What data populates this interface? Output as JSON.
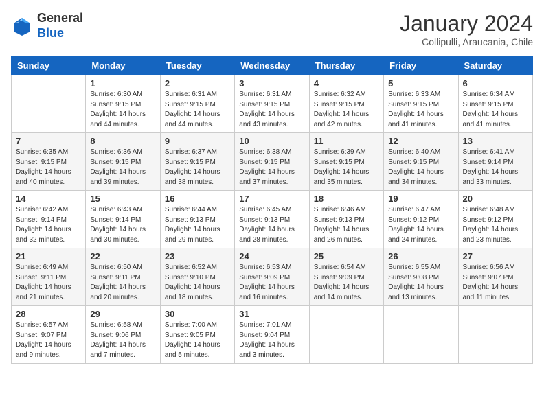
{
  "header": {
    "logo_general": "General",
    "logo_blue": "Blue",
    "month_title": "January 2024",
    "subtitle": "Collipulli, Araucania, Chile"
  },
  "days_of_week": [
    "Sunday",
    "Monday",
    "Tuesday",
    "Wednesday",
    "Thursday",
    "Friday",
    "Saturday"
  ],
  "weeks": [
    [
      {
        "day": "",
        "sunrise": "",
        "sunset": "",
        "daylight": ""
      },
      {
        "day": "1",
        "sunrise": "Sunrise: 6:30 AM",
        "sunset": "Sunset: 9:15 PM",
        "daylight": "Daylight: 14 hours and 44 minutes."
      },
      {
        "day": "2",
        "sunrise": "Sunrise: 6:31 AM",
        "sunset": "Sunset: 9:15 PM",
        "daylight": "Daylight: 14 hours and 44 minutes."
      },
      {
        "day": "3",
        "sunrise": "Sunrise: 6:31 AM",
        "sunset": "Sunset: 9:15 PM",
        "daylight": "Daylight: 14 hours and 43 minutes."
      },
      {
        "day": "4",
        "sunrise": "Sunrise: 6:32 AM",
        "sunset": "Sunset: 9:15 PM",
        "daylight": "Daylight: 14 hours and 42 minutes."
      },
      {
        "day": "5",
        "sunrise": "Sunrise: 6:33 AM",
        "sunset": "Sunset: 9:15 PM",
        "daylight": "Daylight: 14 hours and 41 minutes."
      },
      {
        "day": "6",
        "sunrise": "Sunrise: 6:34 AM",
        "sunset": "Sunset: 9:15 PM",
        "daylight": "Daylight: 14 hours and 41 minutes."
      }
    ],
    [
      {
        "day": "7",
        "sunrise": "Sunrise: 6:35 AM",
        "sunset": "Sunset: 9:15 PM",
        "daylight": "Daylight: 14 hours and 40 minutes."
      },
      {
        "day": "8",
        "sunrise": "Sunrise: 6:36 AM",
        "sunset": "Sunset: 9:15 PM",
        "daylight": "Daylight: 14 hours and 39 minutes."
      },
      {
        "day": "9",
        "sunrise": "Sunrise: 6:37 AM",
        "sunset": "Sunset: 9:15 PM",
        "daylight": "Daylight: 14 hours and 38 minutes."
      },
      {
        "day": "10",
        "sunrise": "Sunrise: 6:38 AM",
        "sunset": "Sunset: 9:15 PM",
        "daylight": "Daylight: 14 hours and 37 minutes."
      },
      {
        "day": "11",
        "sunrise": "Sunrise: 6:39 AM",
        "sunset": "Sunset: 9:15 PM",
        "daylight": "Daylight: 14 hours and 35 minutes."
      },
      {
        "day": "12",
        "sunrise": "Sunrise: 6:40 AM",
        "sunset": "Sunset: 9:15 PM",
        "daylight": "Daylight: 14 hours and 34 minutes."
      },
      {
        "day": "13",
        "sunrise": "Sunrise: 6:41 AM",
        "sunset": "Sunset: 9:14 PM",
        "daylight": "Daylight: 14 hours and 33 minutes."
      }
    ],
    [
      {
        "day": "14",
        "sunrise": "Sunrise: 6:42 AM",
        "sunset": "Sunset: 9:14 PM",
        "daylight": "Daylight: 14 hours and 32 minutes."
      },
      {
        "day": "15",
        "sunrise": "Sunrise: 6:43 AM",
        "sunset": "Sunset: 9:14 PM",
        "daylight": "Daylight: 14 hours and 30 minutes."
      },
      {
        "day": "16",
        "sunrise": "Sunrise: 6:44 AM",
        "sunset": "Sunset: 9:13 PM",
        "daylight": "Daylight: 14 hours and 29 minutes."
      },
      {
        "day": "17",
        "sunrise": "Sunrise: 6:45 AM",
        "sunset": "Sunset: 9:13 PM",
        "daylight": "Daylight: 14 hours and 28 minutes."
      },
      {
        "day": "18",
        "sunrise": "Sunrise: 6:46 AM",
        "sunset": "Sunset: 9:13 PM",
        "daylight": "Daylight: 14 hours and 26 minutes."
      },
      {
        "day": "19",
        "sunrise": "Sunrise: 6:47 AM",
        "sunset": "Sunset: 9:12 PM",
        "daylight": "Daylight: 14 hours and 24 minutes."
      },
      {
        "day": "20",
        "sunrise": "Sunrise: 6:48 AM",
        "sunset": "Sunset: 9:12 PM",
        "daylight": "Daylight: 14 hours and 23 minutes."
      }
    ],
    [
      {
        "day": "21",
        "sunrise": "Sunrise: 6:49 AM",
        "sunset": "Sunset: 9:11 PM",
        "daylight": "Daylight: 14 hours and 21 minutes."
      },
      {
        "day": "22",
        "sunrise": "Sunrise: 6:50 AM",
        "sunset": "Sunset: 9:11 PM",
        "daylight": "Daylight: 14 hours and 20 minutes."
      },
      {
        "day": "23",
        "sunrise": "Sunrise: 6:52 AM",
        "sunset": "Sunset: 9:10 PM",
        "daylight": "Daylight: 14 hours and 18 minutes."
      },
      {
        "day": "24",
        "sunrise": "Sunrise: 6:53 AM",
        "sunset": "Sunset: 9:09 PM",
        "daylight": "Daylight: 14 hours and 16 minutes."
      },
      {
        "day": "25",
        "sunrise": "Sunrise: 6:54 AM",
        "sunset": "Sunset: 9:09 PM",
        "daylight": "Daylight: 14 hours and 14 minutes."
      },
      {
        "day": "26",
        "sunrise": "Sunrise: 6:55 AM",
        "sunset": "Sunset: 9:08 PM",
        "daylight": "Daylight: 14 hours and 13 minutes."
      },
      {
        "day": "27",
        "sunrise": "Sunrise: 6:56 AM",
        "sunset": "Sunset: 9:07 PM",
        "daylight": "Daylight: 14 hours and 11 minutes."
      }
    ],
    [
      {
        "day": "28",
        "sunrise": "Sunrise: 6:57 AM",
        "sunset": "Sunset: 9:07 PM",
        "daylight": "Daylight: 14 hours and 9 minutes."
      },
      {
        "day": "29",
        "sunrise": "Sunrise: 6:58 AM",
        "sunset": "Sunset: 9:06 PM",
        "daylight": "Daylight: 14 hours and 7 minutes."
      },
      {
        "day": "30",
        "sunrise": "Sunrise: 7:00 AM",
        "sunset": "Sunset: 9:05 PM",
        "daylight": "Daylight: 14 hours and 5 minutes."
      },
      {
        "day": "31",
        "sunrise": "Sunrise: 7:01 AM",
        "sunset": "Sunset: 9:04 PM",
        "daylight": "Daylight: 14 hours and 3 minutes."
      },
      {
        "day": "",
        "sunrise": "",
        "sunset": "",
        "daylight": ""
      },
      {
        "day": "",
        "sunrise": "",
        "sunset": "",
        "daylight": ""
      },
      {
        "day": "",
        "sunrise": "",
        "sunset": "",
        "daylight": ""
      }
    ]
  ]
}
